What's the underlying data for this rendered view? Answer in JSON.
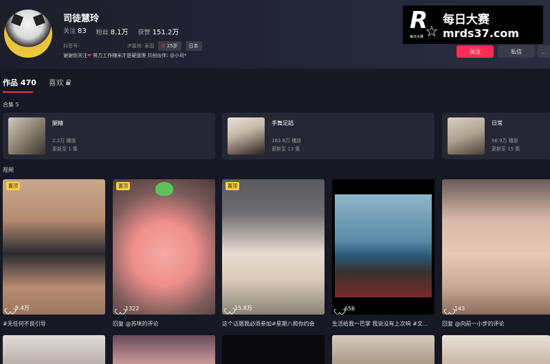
{
  "profile": {
    "name": "司徒慧玲",
    "following_label": "关注",
    "following_count": "83",
    "followers_label": "粉丝",
    "followers_count": "8.1万",
    "likes_label": "获赞",
    "likes_count": "151.2万",
    "douyin_id_label": "抖音号:",
    "ip_label": "IP属地: 泰国",
    "age_tag": "25岁",
    "country_tag": "日本",
    "bio_prefix": "谢谢你关注",
    "bio_suffix": " 努力工作赚米才是硬道理 共创伙伴: @小司*"
  },
  "watermark": {
    "logo_letter": "R",
    "logo_sub": "每日大赛",
    "title": "每日大赛",
    "url": "mrds37.com"
  },
  "actions": {
    "follow": "关注",
    "message": "私信",
    "more": "..."
  },
  "tabs": {
    "works": "作品 470",
    "liked": "喜欢"
  },
  "collections_header": "合集 5",
  "collections": [
    {
      "name": "腿精",
      "plays": "2.2万 播放",
      "updated": "更新至 1 集"
    },
    {
      "name": "手舞足蹈",
      "plays": "163.8万 播放",
      "updated": "更新至 13 集"
    },
    {
      "name": "日常",
      "plays": "96.9万 播放",
      "updated": "更新至 15 集"
    }
  ],
  "videos_header": "视频",
  "videos": [
    {
      "pinned": "置顶",
      "likes": "9.4万",
      "title": "#无任何不良引导"
    },
    {
      "pinned": "置顶",
      "likes": "1322",
      "title": "回复 @苏咪的评论"
    },
    {
      "pinned": "置顶",
      "likes": "15.8万",
      "title": "这个话题我必须参加#星期八和你约会"
    },
    {
      "pinned": "",
      "likes": "656",
      "title": "生活给我一巴掌 我说没有上次响 #文..."
    },
    {
      "pinned": "",
      "likes": "143",
      "title": "回复 @向前一小步的评论"
    }
  ],
  "colors": {
    "accent": "#fe2c55",
    "background": "#161823",
    "card": "#252735",
    "pin": "#f8d04a"
  }
}
